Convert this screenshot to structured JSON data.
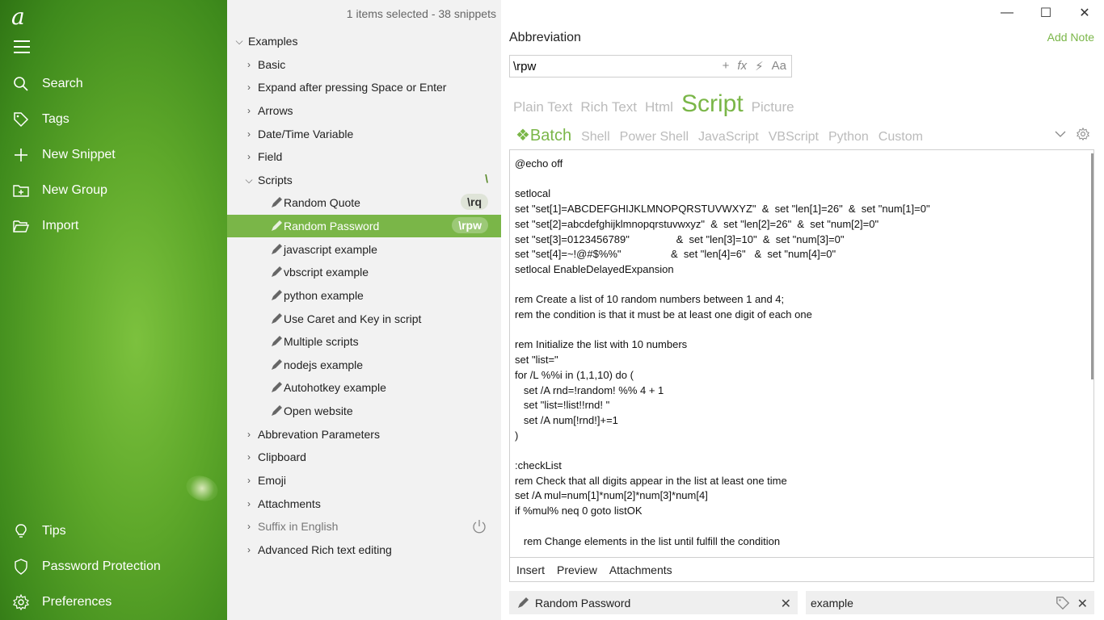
{
  "app": {
    "logo": "a"
  },
  "sidebar": {
    "items": [
      {
        "label": "Search",
        "icon": "search-icon"
      },
      {
        "label": "Tags",
        "icon": "tag-icon"
      },
      {
        "label": "New Snippet",
        "icon": "plus-icon"
      },
      {
        "label": "New Group",
        "icon": "folder-plus-icon"
      },
      {
        "label": "Import",
        "icon": "folder-open-icon"
      },
      {
        "label": "Tips",
        "icon": "lightbulb-icon"
      },
      {
        "label": "Password Protection",
        "icon": "shield-icon"
      },
      {
        "label": "Preferences",
        "icon": "gear-icon"
      }
    ]
  },
  "tree": {
    "status": "1 items selected - 38 snippets",
    "root": "Examples",
    "groups": [
      "Basic",
      "Expand after pressing Space or Enter",
      "Arrows",
      "Date/Time Variable",
      "Field"
    ],
    "scripts_group": {
      "label": "Scripts",
      "badge": "\\"
    },
    "scripts": [
      {
        "label": "Random Quote",
        "badge": "\\rq"
      },
      {
        "label": "Random Password",
        "badge": "\\rpw"
      },
      {
        "label": "javascript example"
      },
      {
        "label": "vbscript example"
      },
      {
        "label": "python example"
      },
      {
        "label": "Use Caret and Key in script"
      },
      {
        "label": "Multiple scripts"
      },
      {
        "label": "nodejs example"
      },
      {
        "label": "Autohotkey example"
      },
      {
        "label": "Open website"
      }
    ],
    "groups_after": [
      "Abbrevation Parameters",
      "Clipboard",
      "Emoji",
      "Attachments",
      "Suffix in English",
      "Advanced Rich text editing"
    ]
  },
  "editor": {
    "abbreviation_label": "Abbreviation",
    "add_note": "Add Note",
    "abbreviation_value": "\\rpw",
    "abbr_tools": [
      "+",
      "fx",
      "⚡",
      "Aa"
    ],
    "type_tabs": [
      "Plain Text",
      "Rich Text",
      "Html",
      "Script",
      "Picture"
    ],
    "active_type": "Script",
    "lang_tabs": [
      "❖Batch",
      "Shell",
      "Power Shell",
      "JavaScript",
      "VBScript",
      "Python",
      "Custom"
    ],
    "active_lang": "❖Batch",
    "code": "@echo off\n\nsetlocal\nset \"set[1]=ABCDEFGHIJKLMNOPQRSTUVWXYZ\"  &  set \"len[1]=26\"  &  set \"num[1]=0\"\nset \"set[2]=abcdefghijklmnopqrstuvwxyz\"  &  set \"len[2]=26\"  &  set \"num[2]=0\"\nset \"set[3]=0123456789\"                &  set \"len[3]=10\"  &  set \"num[3]=0\"\nset \"set[4]=~!@#$%%\"                 &  set \"len[4]=6\"   &  set \"num[4]=0\"\nsetlocal EnableDelayedExpansion\n\nrem Create a list of 10 random numbers between 1 and 4;\nrem the condition is that it must be at least one digit of each one\n\nrem Initialize the list with 10 numbers\nset \"list=\"\nfor /L %%i in (1,1,10) do (\n   set /A rnd=!random! %% 4 + 1\n   set \"list=!list!!rnd! \"\n   set /A num[!rnd!]+=1\n)\n\n:checkList\nrem Check that all digits appear in the list at least one time\nset /A mul=num[1]*num[2]*num[3]*num[4]\nif %mul% neq 0 goto listOK\n\n   rem Change elements in the list until fulfill the condition",
    "bottom_tabs": [
      "Insert",
      "Preview",
      "Attachments"
    ],
    "footer_snippet_name": "Random Password",
    "footer_tag": "example",
    "window_buttons": [
      "—",
      "☐",
      "✕"
    ]
  },
  "colors": {
    "accent": "#7ab648",
    "sidebar": "#5ea82a"
  }
}
